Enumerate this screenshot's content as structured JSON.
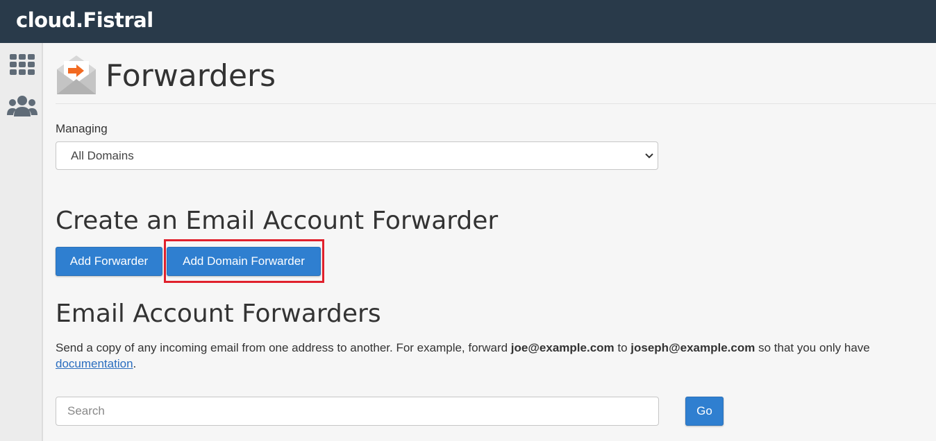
{
  "app": {
    "brand": "cloud.Fistral"
  },
  "sidebar": {
    "items": [
      {
        "icon": "grid-icon"
      },
      {
        "icon": "users-icon"
      }
    ]
  },
  "page": {
    "title": "Forwarders"
  },
  "managing": {
    "label": "Managing",
    "selected": "All Domains"
  },
  "create_section": {
    "heading": "Create an Email Account Forwarder",
    "add_forwarder_label": "Add Forwarder",
    "add_domain_forwarder_label": "Add Domain Forwarder"
  },
  "forwarders_section": {
    "heading": "Email Account Forwarders",
    "desc_part1": "Send a copy of any incoming email from one address to another. For example, forward ",
    "desc_example1": "joe@example.com",
    "desc_part2": " to ",
    "desc_example2": "joseph@example.com",
    "desc_part3": " so that you only have",
    "doc_link": "documentation",
    "desc_end": "."
  },
  "search": {
    "placeholder": "Search",
    "go_label": "Go"
  },
  "colors": {
    "topbar": "#293a4a",
    "primary": "#2f7fd0",
    "highlight": "#e0202c",
    "icon_accent": "#f26a21"
  }
}
